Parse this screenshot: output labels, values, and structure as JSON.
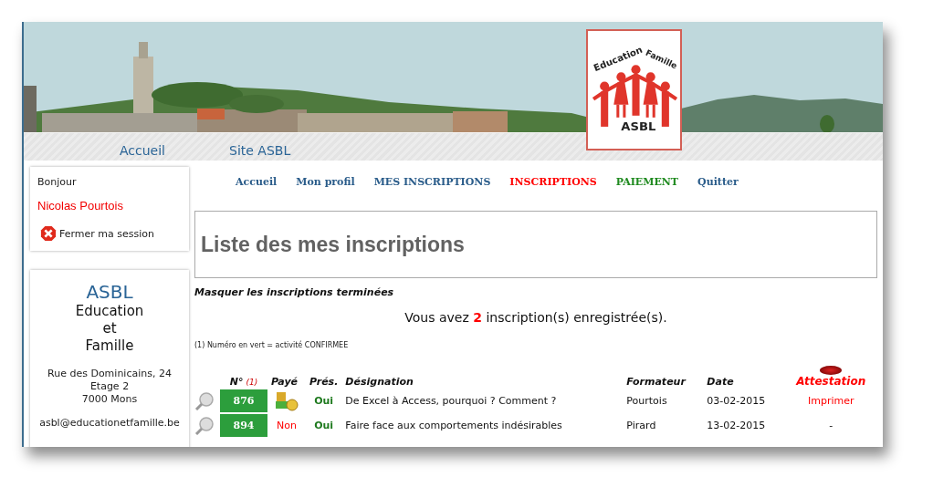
{
  "logo": {
    "top_left": "Education",
    "top_right": "Famille",
    "bottom": "ASBL"
  },
  "nav": [
    {
      "label": "Accueil"
    },
    {
      "label": "Site ASBL"
    }
  ],
  "session": {
    "greeting": "Bonjour",
    "user": "Nicolas Pourtois",
    "logout": "Fermer ma session"
  },
  "org": {
    "name": "ASBL",
    "lines": [
      "Education",
      "et",
      "Famille"
    ],
    "address": [
      "Rue des Dominicains, 24",
      "Etage 2",
      "7000 Mons"
    ],
    "email": "asbl@educationetfamille.be"
  },
  "menu": [
    {
      "label": "Accueil",
      "kind": "normal"
    },
    {
      "label": "Mon profil",
      "kind": "normal"
    },
    {
      "label": "MES INSCRIPTIONS",
      "kind": "normal"
    },
    {
      "label": "INSCRIPTIONS",
      "kind": "alert"
    },
    {
      "label": "PAIEMENT",
      "kind": "ok"
    },
    {
      "label": "Quitter",
      "kind": "normal"
    }
  ],
  "title": "Liste des mes inscriptions",
  "hide_link": "Masquer les inscriptions terminées",
  "summary": "Vous avez **2** inscription(s) enregistrée(s).",
  "note": "(1) Numéro en vert = activité CONFIRMEE",
  "table": {
    "columns": [
      "N°",
      "Payé",
      "Prés.",
      "Désignation",
      "Formateur",
      "Date",
      "Attestation"
    ],
    "number_note": "(1)",
    "rows": [
      {
        "number": "876",
        "confirmed": true,
        "paid": true,
        "presence": "Oui",
        "designation": "De Excel à Access, pourquoi ? Comment ?",
        "trainer": "Pourtois",
        "date": "03-02-2015",
        "certificate": "Imprimer",
        "printable": true
      },
      {
        "number": "894",
        "confirmed": true,
        "paid": false,
        "paid_label": "Non",
        "presence": "Oui",
        "designation": "Faire face aux comportements indésirables",
        "trainer": "Pirard",
        "date": "13-02-2015",
        "certificate": "-",
        "printable": false
      }
    ]
  }
}
